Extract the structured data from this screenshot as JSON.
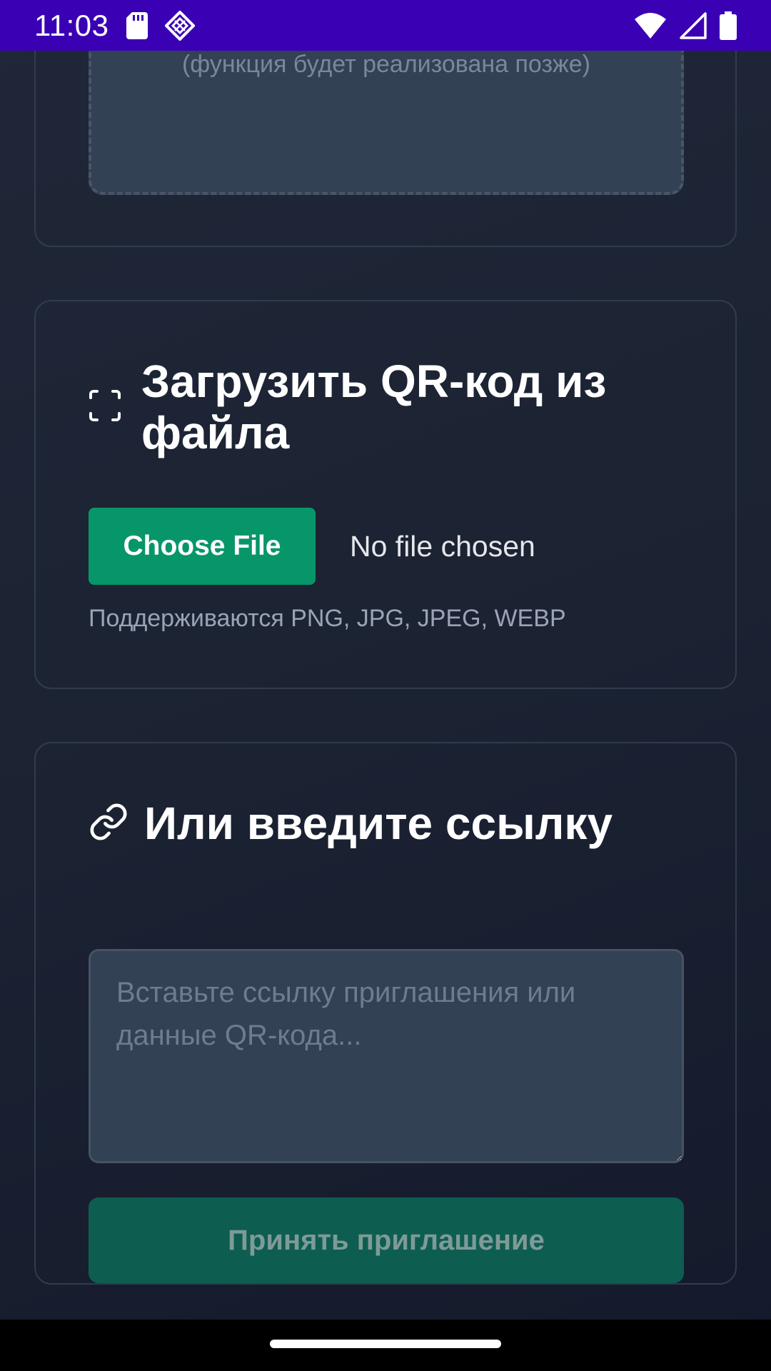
{
  "status_bar": {
    "time": "11:03",
    "bg_color": "#3a00b4",
    "left_icons": [
      "sd-card-icon",
      "diamond-app-icon"
    ],
    "right_icons": [
      "wifi-icon",
      "cell-signal-icon",
      "battery-icon"
    ]
  },
  "camera_card": {
    "note": "(функция будет реализована позже)"
  },
  "file_card": {
    "icon": "qr-scan-frame-icon",
    "title": "Загрузить QR-код из файла",
    "choose_button": "Choose File",
    "file_status": "No file chosen",
    "hint": "Поддерживаются PNG, JPG, JPEG, WEBP",
    "button_color": "#079669"
  },
  "link_card": {
    "icon": "link-icon",
    "title": "Или введите ссылку",
    "input_placeholder": "Вставьте ссылку приглашения или данные QR-кода...",
    "input_value": "",
    "accept_button": "Принять приглашение",
    "accept_button_color": "#0d5e50"
  },
  "colors": {
    "background": "#1c2333",
    "card_border": "#323b4d",
    "input_bg": "#334155"
  }
}
